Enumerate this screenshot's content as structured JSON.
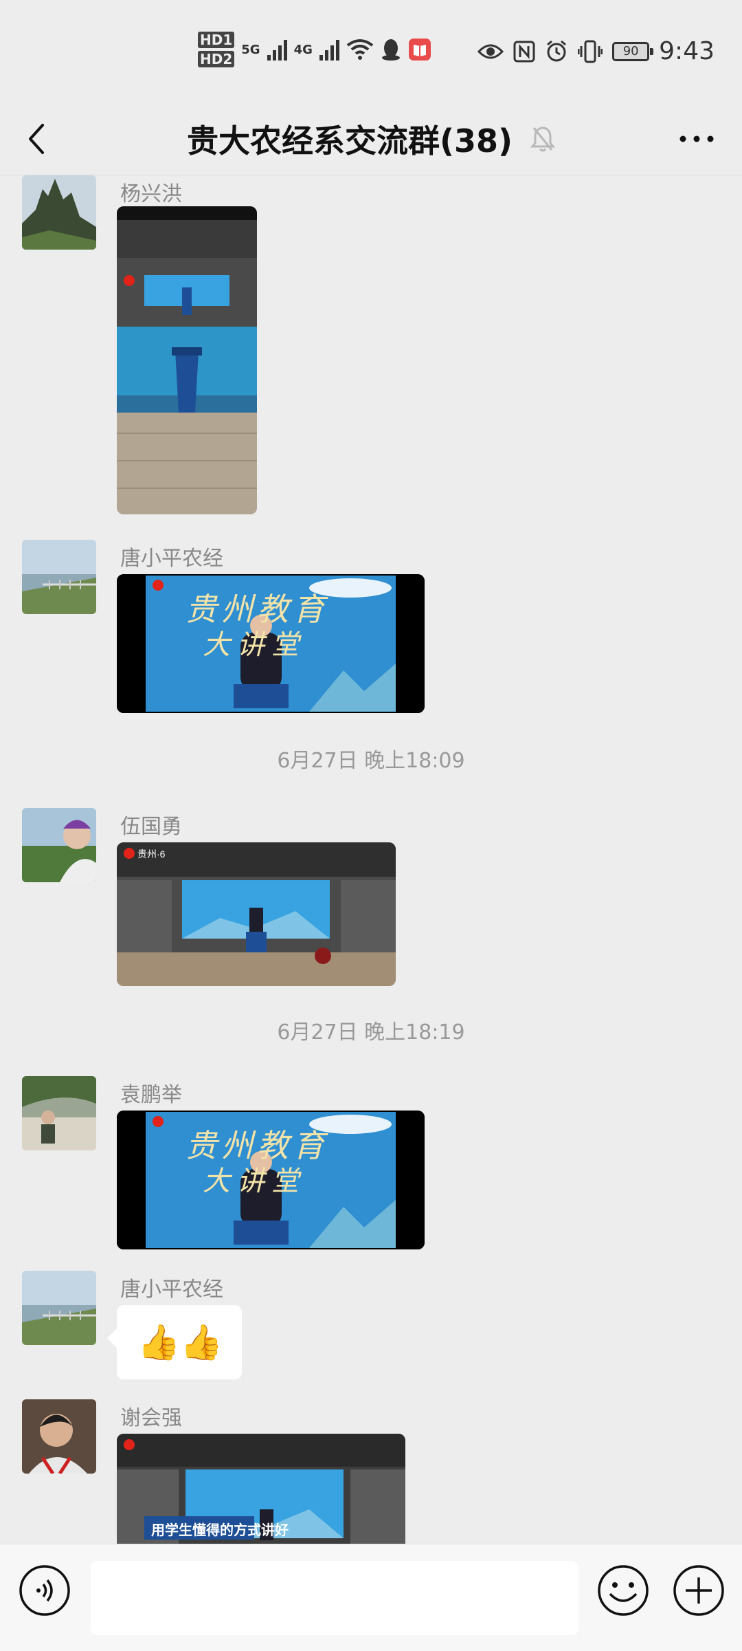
{
  "status_bar": {
    "hd1": "HD1",
    "hd2": "HD2",
    "net1": "5G",
    "net2": "4G",
    "battery": "90",
    "time": "9:43"
  },
  "header": {
    "title": "贵大农经系交流群(38)",
    "mute_icon": "bell-off-icon",
    "more_icon": "ellipsis-icon"
  },
  "messages": [
    {
      "sender": "杨兴洪",
      "type": "video"
    },
    {
      "sender": "唐小平农经",
      "type": "video"
    },
    {
      "timestamp": "6月27日 晚上18:09"
    },
    {
      "sender": "伍国勇",
      "type": "video"
    },
    {
      "timestamp": "6月27日 晚上18:19"
    },
    {
      "sender": "袁鹏举",
      "type": "video"
    },
    {
      "sender": "唐小平农经",
      "type": "emoji",
      "content": "👍👍"
    },
    {
      "sender": "谢会强",
      "type": "video"
    }
  ],
  "video_captions": {
    "banner_line1": "贵州教育",
    "banner_line2": "大讲堂",
    "subtitle": "用学生懂得的方式讲好",
    "channel": "贵州·6"
  },
  "input_bar": {
    "voice_icon": "voice-icon",
    "emoji_icon": "emoji-icon",
    "plus_icon": "plus-icon",
    "placeholder": ""
  },
  "colors": {
    "background": "#ededed",
    "stage_blue": "#2f8fd1",
    "podium": "#1e4f96"
  }
}
